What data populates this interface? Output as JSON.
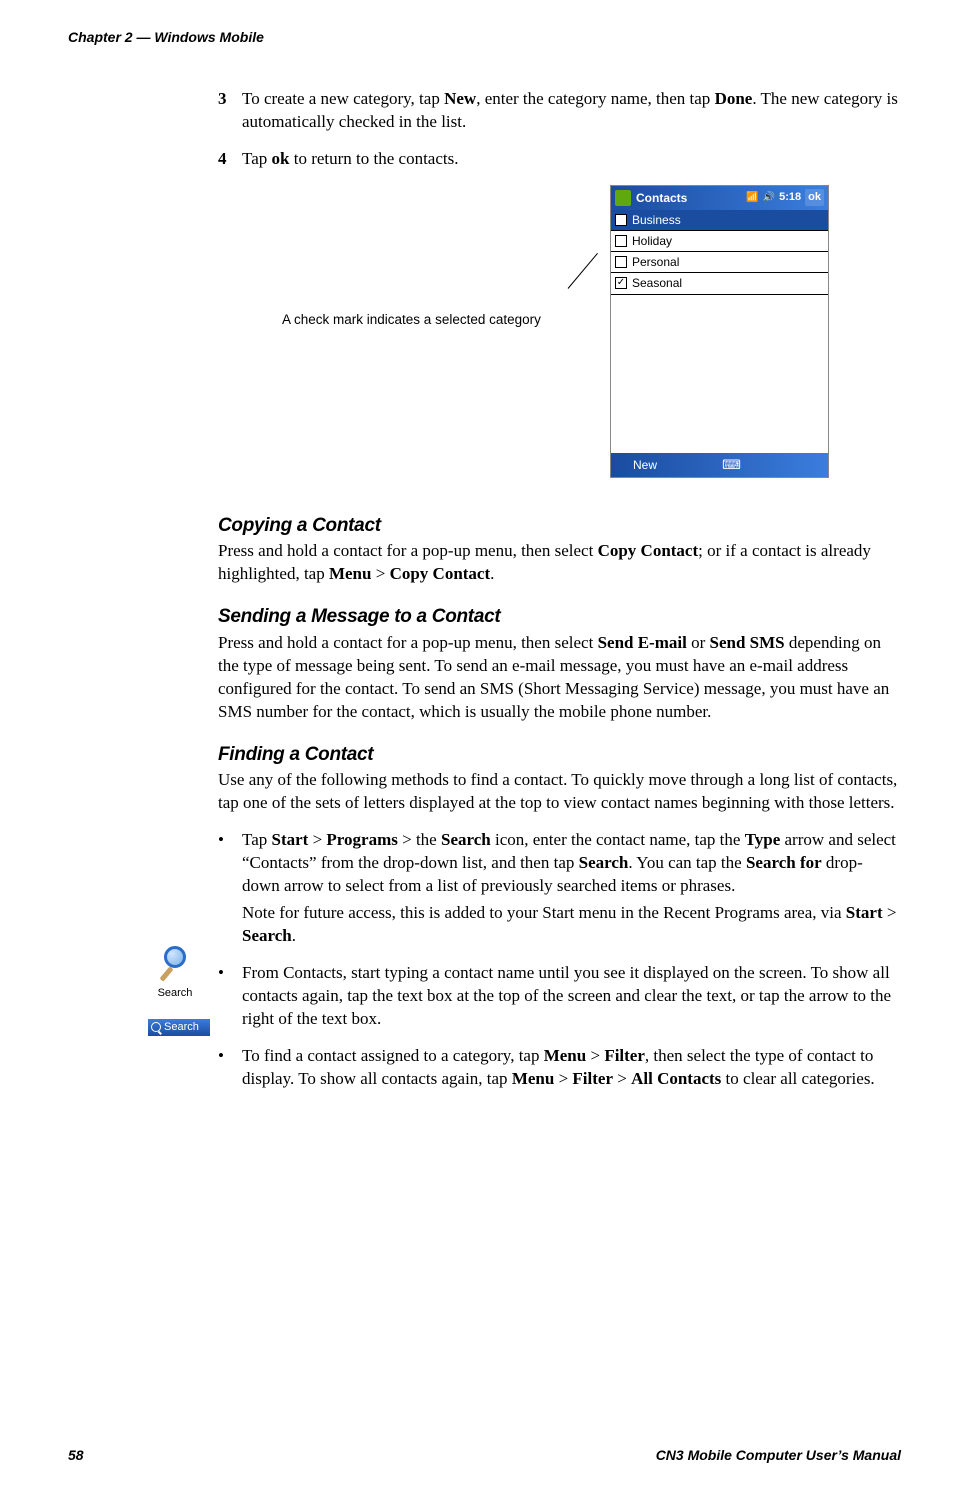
{
  "header": {
    "chapter": "Chapter 2 — Windows Mobile"
  },
  "steps": {
    "s3": {
      "num": "3",
      "pre": "To create a new category, tap ",
      "new": "New",
      "mid": ", enter the category name, then tap ",
      "done": "Done",
      "post": ". The new category is automatically checked in the list."
    },
    "s4": {
      "num": "4",
      "pre": "Tap ",
      "ok": "ok",
      "post": " to return to the contacts."
    }
  },
  "callout": "A check mark indicates a selected category",
  "device": {
    "title": "Contacts",
    "time": "5:18",
    "okbtn": "ok",
    "cats": {
      "business": "Business",
      "holiday": "Holiday",
      "personal": "Personal",
      "seasonal": "Seasonal"
    },
    "newbtn": "New"
  },
  "sections": {
    "copying": {
      "title": "Copying a Contact",
      "t1": "Press and hold a contact for a pop-up menu, then select ",
      "b1": "Copy Contact",
      "t2": "; or if a contact is already highlighted, tap ",
      "b2": "Menu",
      "t3": " > ",
      "b3": "Copy Contact",
      "t4": "."
    },
    "sending": {
      "title": "Sending a Message to a Contact",
      "t1": "Press and hold a contact for a pop-up menu, then select ",
      "b1": "Send E-mail",
      "t2": " or ",
      "b2": "Send SMS",
      "t3": " depending on the type of message being sent. To send an e-mail message, you must have an e-mail address configured for the contact. To send an SMS (Short Messaging Service) message, you must have an SMS number for the contact, which is usually the mobile phone number."
    },
    "finding": {
      "title": "Finding a Contact",
      "intro": "Use any of the following methods to find a contact. To quickly move through a long list of contacts, tap one of the sets of letters displayed at the top to view contact names beginning with those letters."
    }
  },
  "bullets": {
    "b1": {
      "p1_t1": "Tap ",
      "p1_b1": "Start",
      "p1_t2": " > ",
      "p1_b2": "Programs",
      "p1_t3": " > the ",
      "p1_b3": "Search",
      "p1_t4": " icon, enter the contact name, tap the ",
      "p1_b4": "Type",
      "p1_t5": " arrow and select “Contacts” from the drop-down list, and then tap ",
      "p1_b5": "Search",
      "p1_t6": ". You can tap the ",
      "p1_b6": "Search for",
      "p1_t7": " drop-down arrow to select from a list of previously searched items or phrases.",
      "note_t1": "Note for future access, this is added to your Start menu in the Recent Programs area, via ",
      "note_b1": "Start",
      "note_t2": " > ",
      "note_b2": "Search",
      "note_t3": "."
    },
    "b2": "From Contacts, start typing a contact name until you see it displayed on the screen. To show all contacts again, tap the text box at the top of the screen and clear the text, or tap the arrow to the right of the text box.",
    "b3": {
      "t1": "To find a contact assigned to a category, tap ",
      "b1": "Menu",
      "t2": " > ",
      "b2": "Filter",
      "t3": ", then select the type of contact to display. To show all contacts again, tap ",
      "b3": "Menu",
      "t4": " > ",
      "b4": "Filter",
      "t5": " > ",
      "b5": "All Contacts",
      "t6": " to clear all categories."
    }
  },
  "sidebar": {
    "searchlbl": "Search",
    "menulbl": "Search"
  },
  "footer": {
    "page": "58",
    "manual": "CN3 Mobile Computer User’s Manual"
  }
}
